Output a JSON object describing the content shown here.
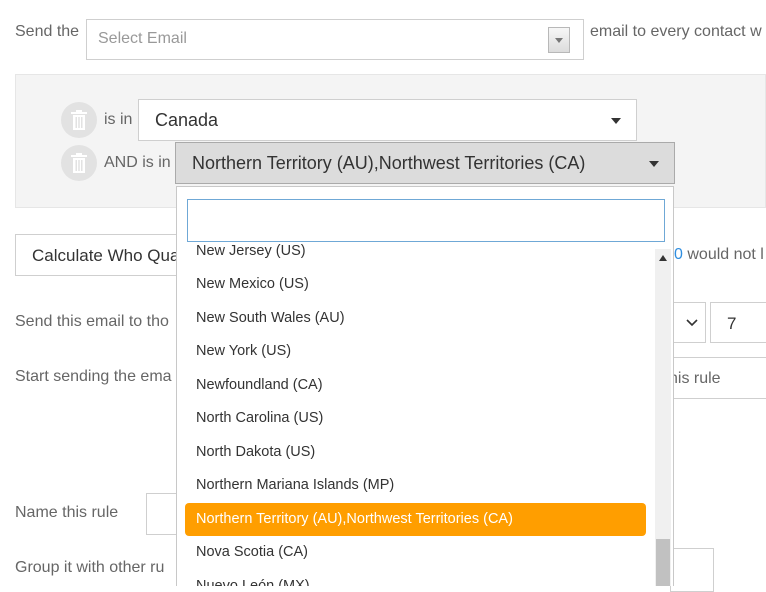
{
  "header": {
    "send_the": "Send the",
    "email_placeholder": "Select Email",
    "suffix": "email to every contact w"
  },
  "conditions": [
    {
      "label": "is in",
      "value": "Canada"
    },
    {
      "label": "AND is in",
      "value": "Northern Territory (AU),Northwest Territories (CA)"
    }
  ],
  "dropdown": {
    "search_value": "",
    "options": [
      "New Jersey (US)",
      "New Mexico (US)",
      "New South Wales (AU)",
      "New York (US)",
      "Newfoundland (CA)",
      "North Carolina (US)",
      "North Dakota (US)",
      "Northern Mariana Islands (MP)",
      "Northern Territory (AU),Northwest Territories (CA)",
      "Nova Scotia (CA)",
      "Nuevo León (MX)"
    ],
    "selected_index": 8
  },
  "calculate": {
    "button_label": "Calculate Who Qua",
    "result_num": "0",
    "result_text": "would not l"
  },
  "send_to": {
    "label": "Send this email to tho",
    "days_value": "7"
  },
  "start_sending": {
    "label": "Start sending the ema",
    "right_text": "his rule"
  },
  "name_rule": {
    "label": "Name this rule"
  },
  "group_rule": {
    "label": "Group it with other ru"
  }
}
